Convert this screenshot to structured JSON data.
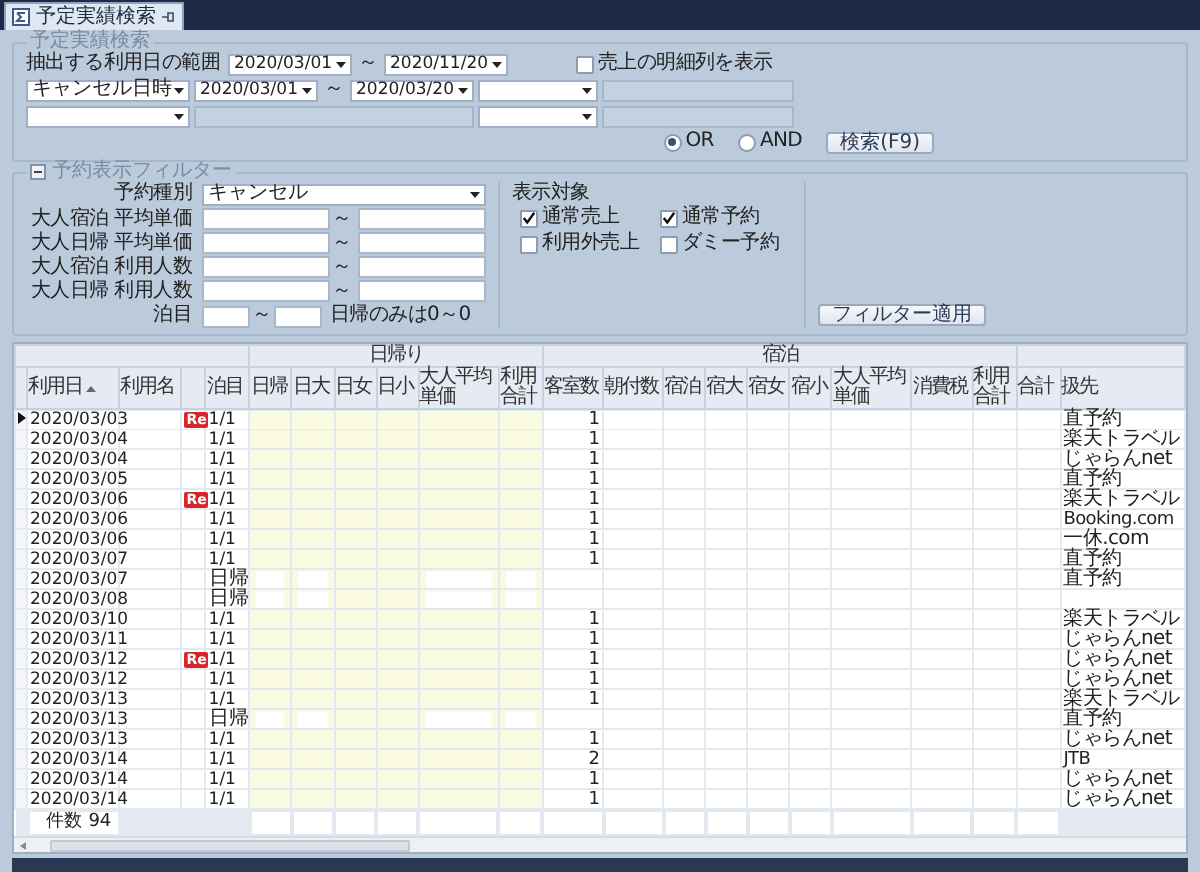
{
  "tab": {
    "label": "予定実績検索",
    "selected": true
  },
  "search": {
    "legend": "予定実績検索",
    "range_label": "抽出する利用日の範囲",
    "range_from": "2020/03/01",
    "range_sep": "～",
    "range_to": "2020/11/20",
    "show_detail": {
      "label": "売上の明細列を表示",
      "checked": false
    },
    "condition": {
      "field": "キャンセル日時",
      "from": "2020/03/01",
      "sep": "～",
      "to": "2020/03/20"
    },
    "match": [
      {
        "label": "OR",
        "selected": true
      },
      {
        "label": "AND",
        "selected": false
      }
    ],
    "search_button": "検索(F9)"
  },
  "filter": {
    "legend": "予約表示フィルター",
    "type_label": "予約種別",
    "type_value": "キャンセル",
    "ranges": [
      {
        "label": "大人宿泊 平均単価",
        "sep": "～"
      },
      {
        "label": "大人日帰 平均単価",
        "sep": "～"
      },
      {
        "label": "大人宿泊 利用人数",
        "sep": "～"
      },
      {
        "label": "大人日帰 利用人数",
        "sep": "～"
      }
    ],
    "nights_label": "泊目",
    "nights_sep": "～",
    "nights_hint": "日帰のみは0～0",
    "targets_label": "表示対象",
    "targets": [
      {
        "label": "通常売上",
        "checked": true
      },
      {
        "label": "通常予約",
        "checked": true
      },
      {
        "label": "利用外売上",
        "checked": false
      },
      {
        "label": "ダミー予約",
        "checked": false
      }
    ],
    "apply_button": "フィルター適用"
  },
  "table": {
    "columns": [
      {
        "label": "利用日",
        "sorted": true
      },
      {
        "label": "利用名",
        "sorted": false
      },
      {
        "label": "泊目",
        "sorted": false
      }
    ],
    "day_group": {
      "label": "日帰り",
      "columns": [
        "日帰",
        "日大",
        "日女",
        "日小",
        "大人平均単価",
        "利用合計"
      ]
    },
    "stay_group": {
      "label": "宿泊",
      "columns": [
        "客室数",
        "朝付数",
        "宿泊",
        "宿大",
        "宿女",
        "宿小",
        "大人平均単価",
        "消費税",
        "利用合計"
      ]
    },
    "tail_columns": [
      "合計",
      "扱先"
    ],
    "rows": [
      {
        "date": "2020/03/03",
        "badge": "Re",
        "night": "1/1",
        "kind": "stay",
        "rooms": "1",
        "channel": "直予約",
        "selected": true
      },
      {
        "date": "2020/03/04",
        "night": "1/1",
        "kind": "stay",
        "rooms": "1",
        "channel": "楽天トラベル",
        "selected": false
      },
      {
        "date": "2020/03/04",
        "night": "1/1",
        "kind": "stay",
        "rooms": "1",
        "channel": "じゃらんnet",
        "selected": false
      },
      {
        "date": "2020/03/05",
        "night": "1/1",
        "kind": "stay",
        "rooms": "1",
        "channel": "直予約",
        "selected": false
      },
      {
        "date": "2020/03/06",
        "badge": "Re",
        "night": "1/1",
        "kind": "stay",
        "rooms": "1",
        "channel": "楽天トラベル",
        "selected": false
      },
      {
        "date": "2020/03/06",
        "night": "1/1",
        "kind": "stay",
        "rooms": "1",
        "channel": "Booking.com",
        "selected": false
      },
      {
        "date": "2020/03/06",
        "night": "1/1",
        "kind": "stay",
        "rooms": "1",
        "channel": "一休.com",
        "selected": false
      },
      {
        "date": "2020/03/07",
        "night": "1/1",
        "kind": "stay",
        "rooms": "1",
        "channel": "直予約",
        "selected": false
      },
      {
        "date": "2020/03/07",
        "night": "日帰",
        "kind": "day",
        "channel": "直予約",
        "selected": false
      },
      {
        "date": "2020/03/08",
        "night": "日帰",
        "kind": "day",
        "selected": false
      },
      {
        "date": "2020/03/10",
        "night": "1/1",
        "kind": "stay",
        "rooms": "1",
        "channel": "楽天トラベル",
        "selected": false
      },
      {
        "date": "2020/03/11",
        "night": "1/1",
        "kind": "stay",
        "rooms": "1",
        "channel": "じゃらんnet",
        "selected": false
      },
      {
        "date": "2020/03/12",
        "badge": "Re",
        "night": "1/1",
        "kind": "stay",
        "rooms": "1",
        "channel": "じゃらんnet",
        "selected": false
      },
      {
        "date": "2020/03/12",
        "night": "1/1",
        "kind": "stay",
        "rooms": "1",
        "channel": "じゃらんnet",
        "selected": false
      },
      {
        "date": "2020/03/13",
        "night": "1/1",
        "kind": "stay",
        "rooms": "1",
        "channel": "楽天トラベル",
        "selected": false
      },
      {
        "date": "2020/03/13",
        "night": "日帰",
        "kind": "day",
        "channel": "直予約",
        "selected": false
      },
      {
        "date": "2020/03/13",
        "night": "1/1",
        "kind": "stay",
        "rooms": "1",
        "channel": "じゃらんnet",
        "selected": false
      },
      {
        "date": "2020/03/14",
        "night": "1/1",
        "kind": "stay",
        "rooms": "2",
        "channel": "JTB",
        "selected": false
      },
      {
        "date": "2020/03/14",
        "night": "1/1",
        "kind": "stay",
        "rooms": "1",
        "channel": "じゃらんnet",
        "selected": false
      },
      {
        "date": "2020/03/14",
        "night": "1/1",
        "kind": "stay",
        "rooms": "1",
        "channel": "じゃらんnet",
        "selected": false
      }
    ],
    "footer": {
      "label": "件数",
      "count": "94"
    }
  }
}
